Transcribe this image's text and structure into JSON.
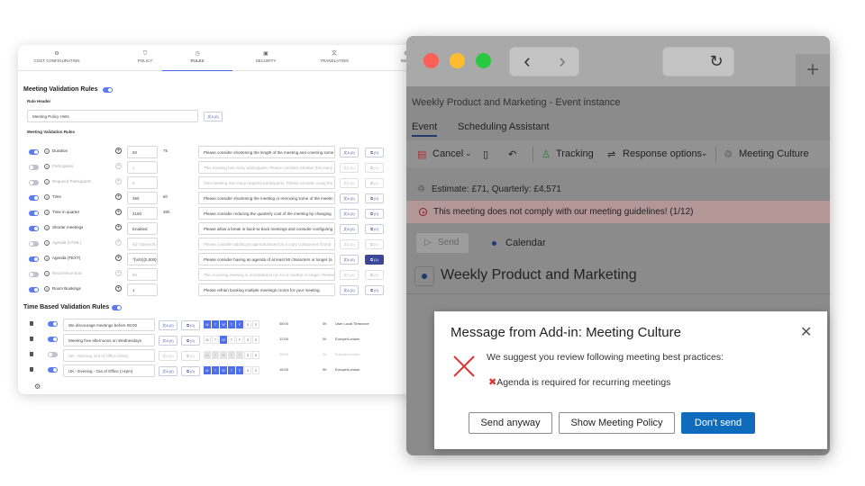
{
  "admin": {
    "tabs": [
      {
        "label": "COST CONFIGURATION",
        "icon": "cost-icon"
      },
      {
        "label": "POLICY",
        "icon": "shield-icon"
      },
      {
        "label": "RULES",
        "icon": "clock-icon",
        "active": true
      },
      {
        "label": "SECURITY",
        "icon": "lock-icon"
      },
      {
        "label": "TRANSLATION",
        "icon": "translate-icon"
      },
      {
        "label": "INSTA",
        "icon": "settings-icon"
      }
    ],
    "section_title": "Meeting Validation Rules",
    "rule_header_label": "Rule Header",
    "rule_header_value": "Meeting Policy Hints",
    "rule_header_btn": "文A (0)",
    "rules_label": "Meeting Validation Rules",
    "rules": [
      {
        "name": "Duration",
        "value": "50",
        "unit": "75",
        "message": "Please consider shortening the length of the meeting and covering some",
        "btn1": "文A (0)",
        "btn2": "⧉ (0)",
        "enabled": true
      },
      {
        "name": "Participants",
        "value": "1",
        "unit": "",
        "message": "This meeting has many participants. Please consider whether this many",
        "btn1": "文A (0)",
        "btn2": "⧉ (0)",
        "enabled": false
      },
      {
        "name": "Required Participants",
        "value": "5",
        "unit": "",
        "message": "Your meeting has many required participants. Please consider using the",
        "btn1": "文A (0)",
        "btn2": "⧉ (0)",
        "enabled": false
      },
      {
        "name": "Time",
        "value": "360",
        "unit": "6h",
        "message": "Please consider shortening the meeting or removing some of the meetin",
        "btn1": "文A (0)",
        "btn2": "⧉ (0)",
        "enabled": true
      },
      {
        "name": "Time in quarter",
        "value": "2160",
        "unit": "36h",
        "message": "Please consider reducing the quarterly cost of the meeting by changing",
        "btn1": "文A (0)",
        "btn2": "⧉ (0)",
        "enabled": true
      },
      {
        "name": "Shorter meetings",
        "value": "Enabled",
        "unit": "",
        "message": "Please allow a break in back-to-back meetings and consider configuring",
        "btn1": "文A (0)",
        "btn2": "⧉ (0)",
        "enabled": true
      },
      {
        "name": "Agenda (HTML)",
        "value": "\\b(?:dearsoft.com\\/join\\/)[\\S]",
        "unit": "",
        "message": "Please consider adding an agenda based on a copy component (found",
        "btn1": "文A (0)",
        "btn2": "⧉ (0)",
        "enabled": false
      },
      {
        "name": "Agenda (TEXT)",
        "value": "^[\\s\\S]{0,500}$",
        "unit": "",
        "message": "Please consider having an agenda of at least 50 characters or longer (a",
        "btn1": "文A (0)",
        "btn2": "⧉ (1)",
        "enabled": true
      },
      {
        "name": "Recurrence End",
        "value": "90",
        "unit": "",
        "message": "This recurring meeting is scheduled to run for 6 months or longer. Please",
        "btn1": "文A (0)",
        "btn2": "⧉ (0)",
        "enabled": false
      },
      {
        "name": "Room Bookings",
        "value": "1",
        "unit": "",
        "message": "Please refrain booking multiple meetings rooms for your meeting.",
        "btn1": "文A (0)",
        "btn2": "⧉ (0)",
        "enabled": true
      }
    ],
    "time_title": "Time Based Validation Rules",
    "time_rules": [
      {
        "name": "We discourage meetings before 08:00",
        "days": "1111100",
        "time": "08:00",
        "dur": "0h",
        "tz": "User Local Timezone",
        "enabled": true
      },
      {
        "name": "Meeting free afternoons on Wednesdays",
        "days": "0010000",
        "time": "12:00",
        "dur": "0h",
        "tz": "Europe/London",
        "enabled": true
      },
      {
        "name": "UK - Morning Out of Office (slots)",
        "days": "1111100",
        "time": "08:00",
        "dur": "0h",
        "tz": "Europe/London",
        "enabled": false
      },
      {
        "name": "UK - Evening - Out of Office (>4pm)",
        "days": "1111100",
        "time": "16:00",
        "dur": "0h",
        "tz": "Europe/London",
        "enabled": true
      }
    ],
    "day_letters": [
      "M",
      "T",
      "W",
      "T",
      "F",
      "S",
      "S"
    ],
    "time_btn1": "文A (0)",
    "time_btn2": "⧉ (0)"
  },
  "outlook": {
    "title": "Weekly Product and Marketing - Event instance",
    "tabs": [
      "Event",
      "Scheduling Assistant"
    ],
    "ribbon": {
      "cancel": "Cancel",
      "tracking": "Tracking",
      "response_options": "Response options",
      "meeting_culture": "Meeting Culture"
    },
    "estimate": "Estimate: £71, Quarterly: £4,571",
    "warning": "This meeting does not comply with our meeting guidelines! (1/12)",
    "send": "Send",
    "calendar": "Calendar",
    "subject": "Weekly Product and Marketing"
  },
  "dialog": {
    "title": "Message from Add-in: Meeting Culture",
    "message": "We suggest you review following meeting best practices:",
    "item": "Agenda is required for recurring meetings",
    "item_mark": "✖",
    "buttons": {
      "send_anyway": "Send anyway",
      "show_policy": "Show Meeting Policy",
      "dont_send": "Don't send"
    }
  },
  "colors": {
    "accent": "#0f6cbd",
    "toggle_on": "#5b7cf0",
    "warning_bg": "#b39696",
    "mac_red": "#fe5f57",
    "mac_yellow": "#febc2e",
    "mac_green": "#28c840"
  }
}
